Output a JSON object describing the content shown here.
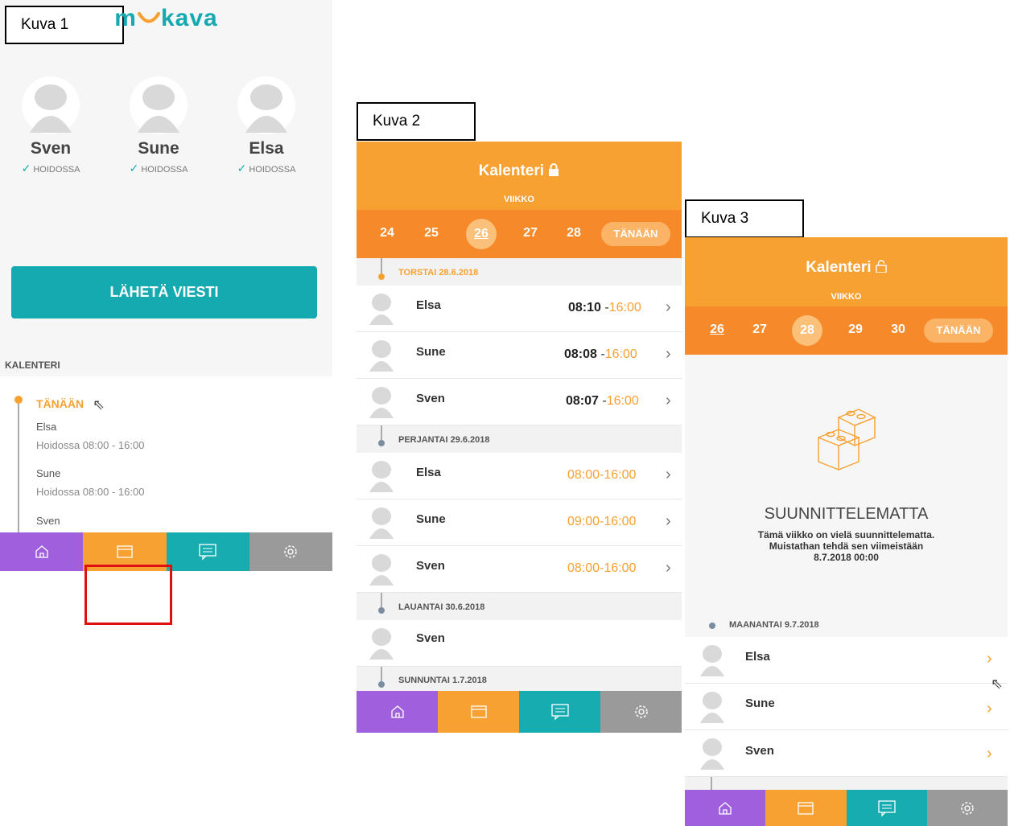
{
  "labels": {
    "kuva1": "Kuva 1",
    "kuva2": "Kuva 2",
    "kuva3": "Kuva 3"
  },
  "colors": {
    "orange": "#f7a133",
    "teal": "#16acb0",
    "purple": "#a060de",
    "gray": "#9a9a9a",
    "highlight_red": "#e01010"
  },
  "screen1": {
    "logo": {
      "part1": "m",
      "part2": "kava"
    },
    "children": [
      {
        "name": "Sven",
        "status": "HOIDOSSA"
      },
      {
        "name": "Sune",
        "status": "HOIDOSSA"
      },
      {
        "name": "Elsa",
        "status": "HOIDOSSA"
      }
    ],
    "send_button": "LÄHETÄ VIESTI",
    "section_title": "KALENTERI",
    "today_label": "TÄNÄÄN",
    "entries": [
      {
        "name": "Elsa",
        "detail": "Hoidossa  08:00 - 16:00"
      },
      {
        "name": "Sune",
        "detail": "Hoidossa  08:00 - 16:00"
      },
      {
        "name": "Sven",
        "detail": ""
      }
    ],
    "nav_icons": [
      "home-icon",
      "calendar-icon",
      "message-icon",
      "settings-icon"
    ]
  },
  "screen2": {
    "title": "Kalenteri",
    "week_label": "VIIKKO",
    "weeks": [
      "24",
      "25",
      "26",
      "27",
      "28"
    ],
    "selected_week": "26",
    "today_button": "TÄNÄÄN",
    "days": [
      {
        "header": "TORSTAI 28.6.2018",
        "rows": [
          {
            "name": "Elsa",
            "start": "08:10",
            "end": "16:00"
          },
          {
            "name": "Sune",
            "start": "08:08",
            "end": "16:00"
          },
          {
            "name": "Sven",
            "start": "08:07",
            "end": "16:00"
          }
        ]
      },
      {
        "header": "PERJANTAI 29.6.2018",
        "rows": [
          {
            "name": "Elsa",
            "planned": "08:00-16:00"
          },
          {
            "name": "Sune",
            "planned": "09:00-16:00"
          },
          {
            "name": "Sven",
            "planned": "08:00-16:00"
          }
        ]
      },
      {
        "header": "LAUANTAI 30.6.2018",
        "rows": [
          {
            "name": "Sven"
          }
        ]
      },
      {
        "header": "SUNNUNTAI 1.7.2018",
        "rows": []
      }
    ]
  },
  "screen3": {
    "title": "Kalenteri",
    "week_label": "VIIKKO",
    "weeks": [
      "26",
      "27",
      "28",
      "29",
      "30"
    ],
    "selected_week": "28",
    "today_button": "TÄNÄÄN",
    "empty_title": "SUUNNITTELEMATTA",
    "empty_text_line1": "Tämä viikko on vielä suunnittelematta.",
    "empty_text_line2": "Muistathan tehdä sen viimeistään",
    "empty_text_line3": "8.7.2018 00:00",
    "day_header": "MAANANTAI 9.7.2018",
    "rows": [
      "Elsa",
      "Sune",
      "Sven"
    ]
  }
}
